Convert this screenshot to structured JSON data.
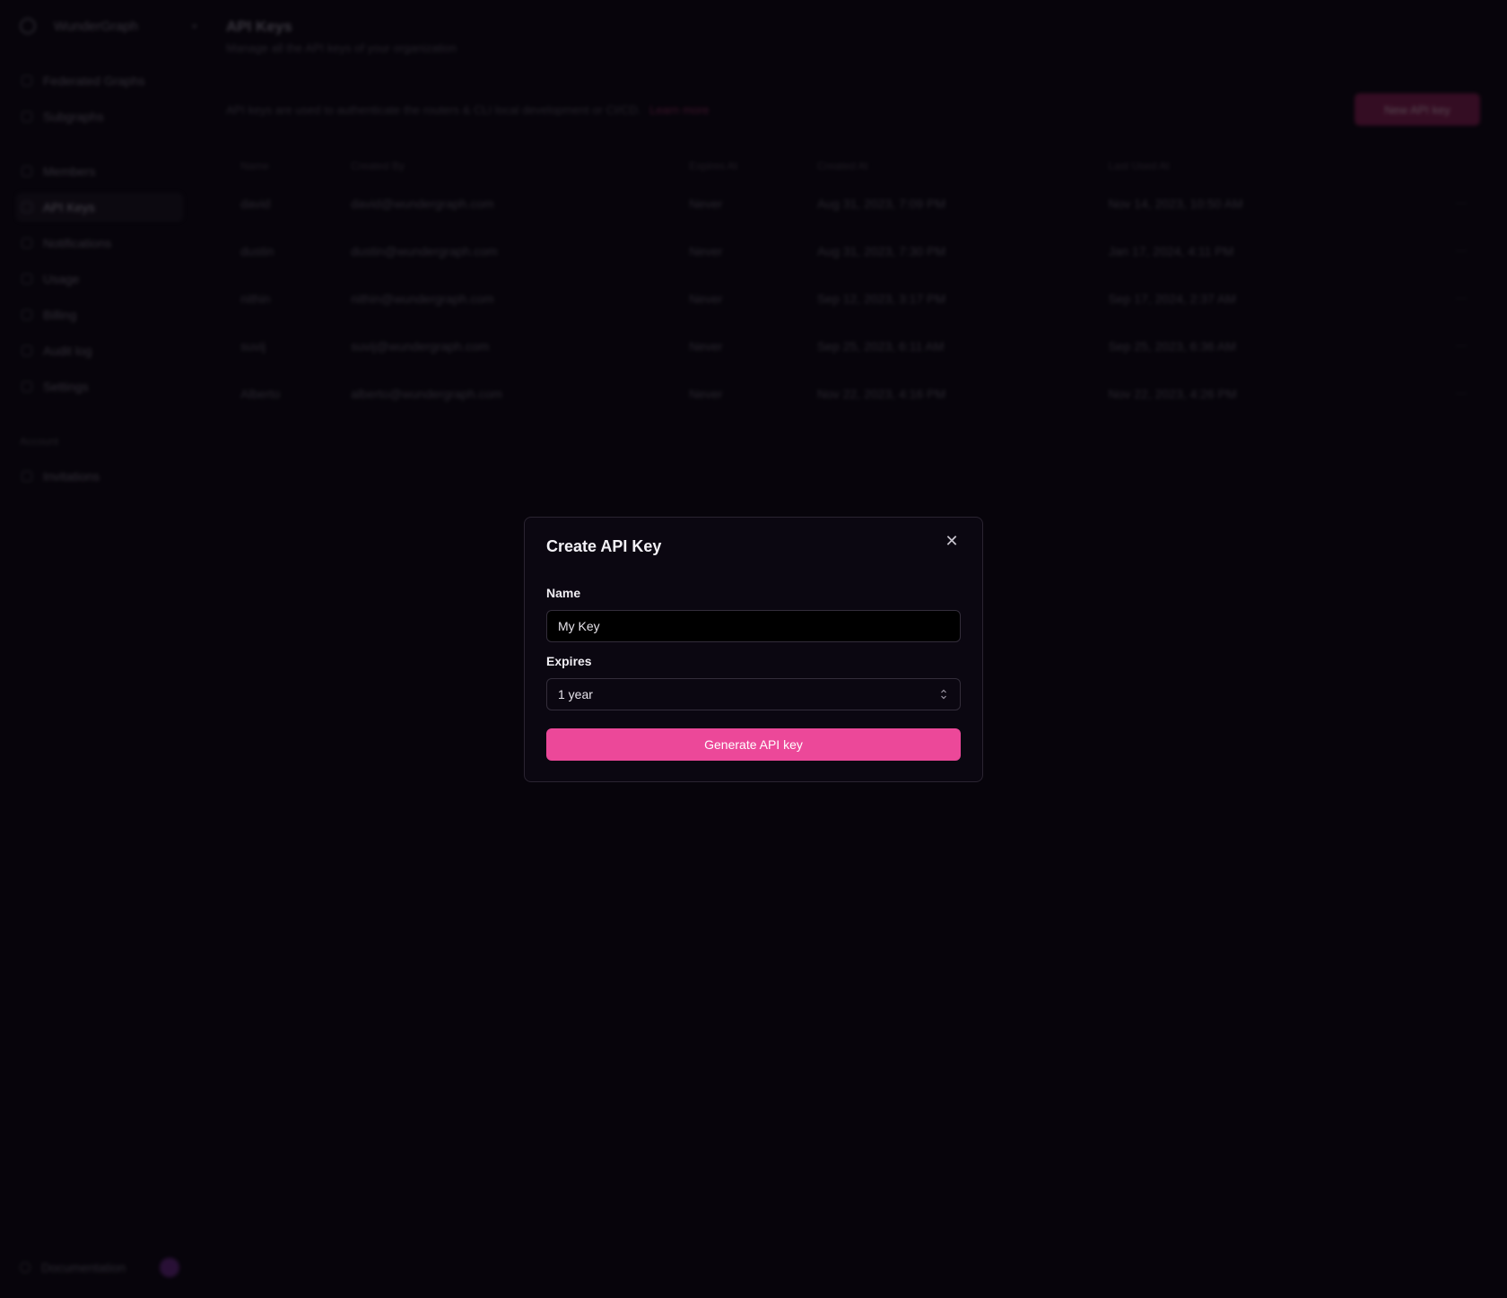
{
  "sidebar": {
    "brand": "WunderGraph",
    "items": [
      {
        "label": "Federated Graphs",
        "icon": "graph-icon"
      },
      {
        "label": "Subgraphs",
        "icon": "subgraph-icon"
      },
      {
        "label": "Members",
        "icon": "members-icon"
      },
      {
        "label": "API Keys",
        "icon": "key-icon",
        "active": true
      },
      {
        "label": "Notifications",
        "icon": "bell-icon"
      },
      {
        "label": "Usage",
        "icon": "chart-icon"
      },
      {
        "label": "Billing",
        "icon": "card-icon"
      },
      {
        "label": "Audit log",
        "icon": "log-icon"
      },
      {
        "label": "Settings",
        "icon": "gear-icon"
      }
    ],
    "section_label": "Account",
    "section_items": [
      {
        "label": "Invitations",
        "icon": "inbox-icon"
      }
    ],
    "footer_label": "Documentation"
  },
  "header": {
    "title": "API Keys",
    "subtitle": "Manage all the API keys of your organization"
  },
  "info": {
    "text": "API keys are used to authenticate the routers & CLI local development or CI/CD.",
    "link": "Learn more"
  },
  "new_key_button": "New API key",
  "table": {
    "columns": [
      "Name",
      "Created By",
      "Expires At",
      "Created At",
      "Last Used At"
    ],
    "rows": [
      [
        "david",
        "david@wundergraph.com",
        "Never",
        "Aug 31, 2023, 7:09 PM",
        "Nov 14, 2023, 10:50 AM"
      ],
      [
        "dustin",
        "dustin@wundergraph.com",
        "Never",
        "Aug 31, 2023, 7:30 PM",
        "Jan 17, 2024, 4:11 PM"
      ],
      [
        "nithin",
        "nithin@wundergraph.com",
        "Never",
        "Sep 12, 2023, 3:17 PM",
        "Sep 17, 2024, 2:37 AM"
      ],
      [
        "suvij",
        "suvij@wundergraph.com",
        "Never",
        "Sep 25, 2023, 6:11 AM",
        "Sep 25, 2023, 6:36 AM"
      ],
      [
        "Alberto",
        "alberto@wundergraph.com",
        "Never",
        "Nov 22, 2023, 4:16 PM",
        "Nov 22, 2023, 4:26 PM"
      ]
    ],
    "row_menu_glyph": "⋯"
  },
  "modal": {
    "title": "Create API Key",
    "close_glyph": "✕",
    "name_label": "Name",
    "name_value": "My Key",
    "expires_label": "Expires",
    "expires_value": "1 year",
    "generate_button": "Generate API key",
    "accent": "#ec4899"
  }
}
